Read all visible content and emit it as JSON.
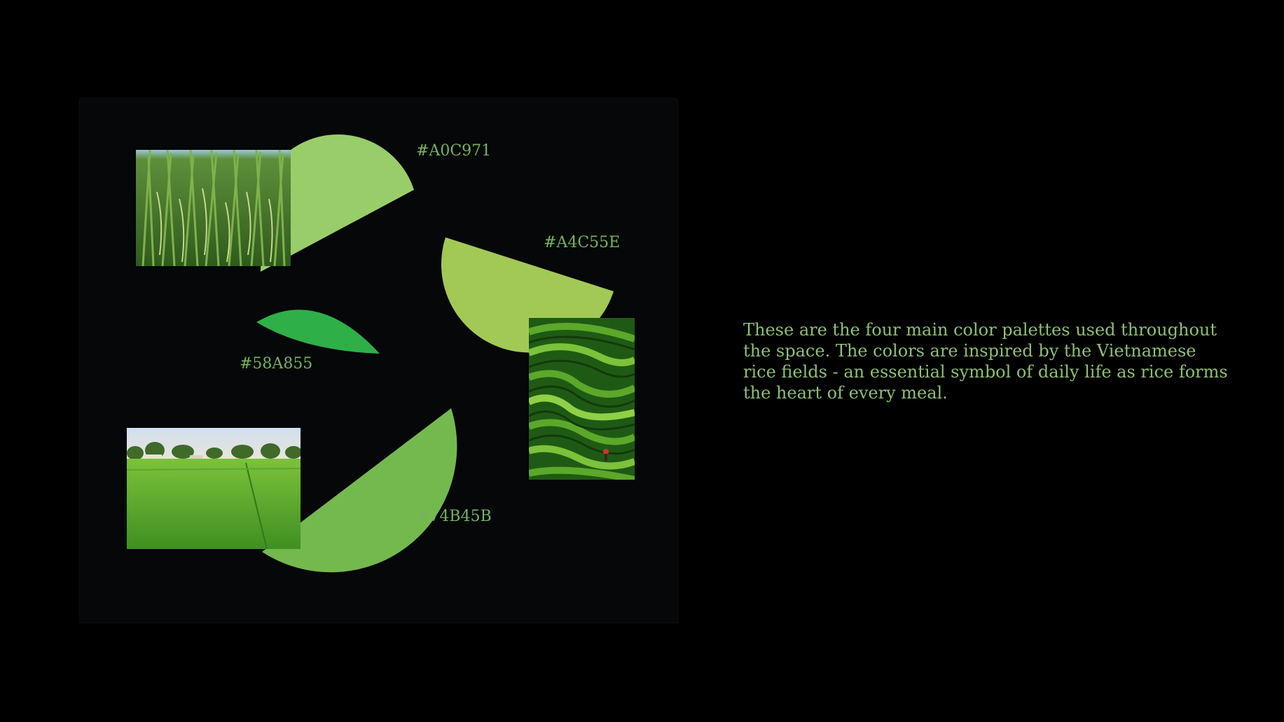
{
  "palette": {
    "swatches": [
      {
        "hex": "#A0C971",
        "label": "#A0C971"
      },
      {
        "hex": "#A4C55E",
        "label": "#A4C55E"
      },
      {
        "hex": "#58A855",
        "label": "#58A855"
      },
      {
        "hex": "#74B45B",
        "label": "#74B45B"
      }
    ]
  },
  "photos": [
    {
      "name": "rice-stalks-photo",
      "subject": "rice stalks close-up"
    },
    {
      "name": "rice-terraces-photo",
      "subject": "rice terraces with farmer"
    },
    {
      "name": "rice-field-photo",
      "subject": "green rice field landscape"
    }
  ],
  "description": {
    "text": "These are the four main color palettes used throughout the space. The colors are inspired by the Vietnamese rice fields - an essential symbol of daily life as rice forms the heart of every meal."
  }
}
